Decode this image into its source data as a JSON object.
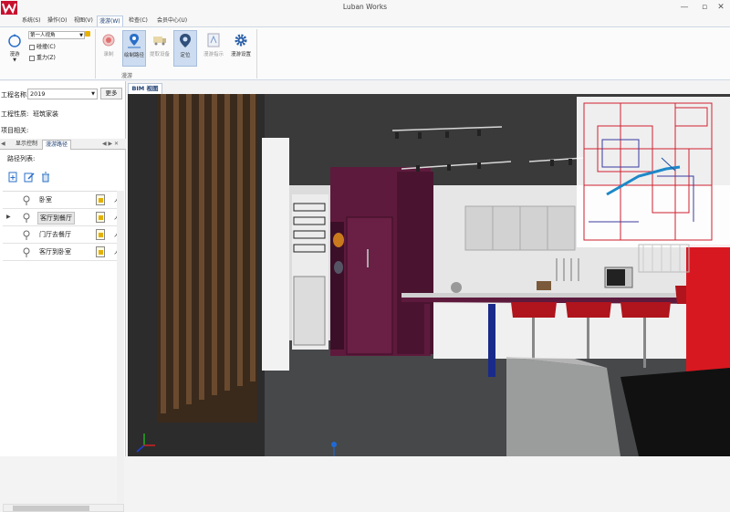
{
  "app": {
    "title": "Luban Works"
  },
  "window": {
    "minimize": "—",
    "maximize": "▫",
    "close": "✕"
  },
  "menu": [
    "系统(S)",
    "操作(O)",
    "视图(V)",
    "漫游(W)",
    "检查(C)",
    "会员中心(U)"
  ],
  "menu_active": "漫游(W)",
  "ribbon": {
    "roam_label": "漫游",
    "view_mode": "第一人视角",
    "collision_label": "碰撞(C)",
    "gravity_label": "重力(Z)",
    "record_label": "录制",
    "draw_path_label": "绘制路径",
    "extract_device_label": "提取设备",
    "locate_label": "定位",
    "roam_hint_label": "漫游指示",
    "roam_settings_label": "漫游设置",
    "group_label": "漫游"
  },
  "left_panel": {
    "project_name_label": "工程名称:",
    "project_name_value": "2019",
    "more_button": "更多",
    "project_nature_label": "工程性质:",
    "project_nature_value": "班筑家装",
    "project_related_label": "项目相关:",
    "tabs": [
      "显示控制",
      "漫游路径"
    ],
    "active_tab": "漫游路径",
    "path_list_title": "路径列表:",
    "paths": [
      {
        "name": "卧室",
        "type": "人"
      },
      {
        "name": "客厅到餐厅",
        "type": "人"
      },
      {
        "name": "门厅去餐厅",
        "type": "人"
      },
      {
        "name": "客厅到卧室",
        "type": "人"
      }
    ],
    "selected_path": "客厅到餐厅"
  },
  "viewport": {
    "tab_label": "BIM 视图"
  },
  "colors": {
    "accent": "#1d3e72",
    "cabinet": "#5e1a3c",
    "stool": "#b0141c",
    "logo": "#c8102e"
  }
}
